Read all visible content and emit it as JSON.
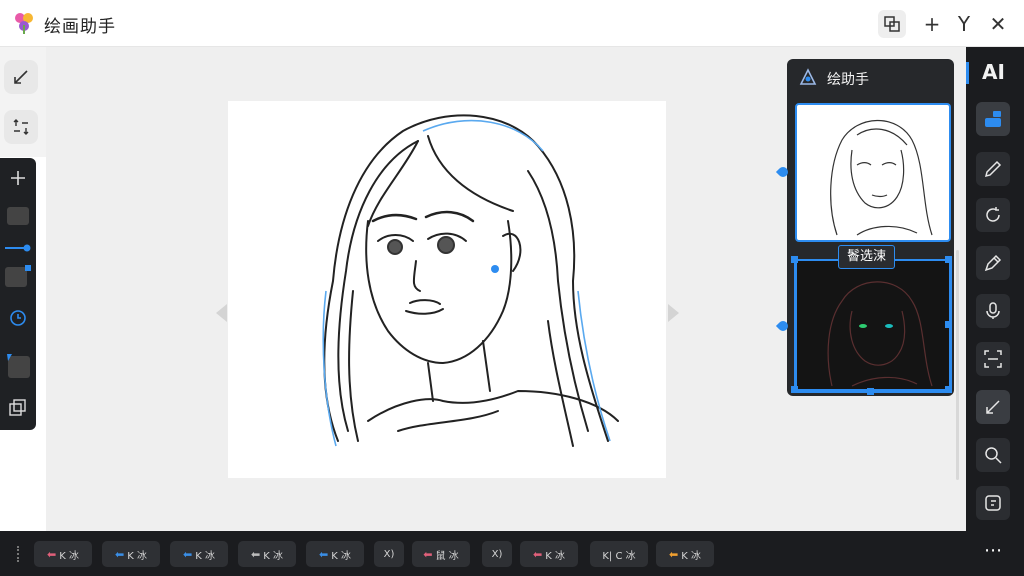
{
  "window": {
    "title": "绘画助手",
    "buttons": {
      "swap": "swap-icon",
      "add": "+",
      "pin": "Y",
      "close": "✕"
    }
  },
  "left_toolbar": {
    "top_tools": [
      "resize-diagonal-icon",
      "transform-arrows-icon"
    ],
    "dark_tools": [
      "plus-icon",
      "layer-block-icon",
      "slider-icon",
      "layer-block-icon",
      "rotate-icon",
      "layer-block-icon",
      "duplicate-icon"
    ]
  },
  "ai_panel": {
    "title": "绘助手",
    "selection_label": "鬠选涑"
  },
  "right_toolbar": {
    "label": "AI",
    "tools": [
      "layers-icon",
      "pencil-icon",
      "refresh-icon",
      "pen-icon",
      "microphone-icon",
      "scan-frame-icon",
      "resize-diagonal-icon",
      "search-icon",
      "export-icon"
    ],
    "more": "⋯"
  },
  "bottom_chips": [
    {
      "arrow": "⬅",
      "text": "K 冰",
      "color": "#e0607a"
    },
    {
      "arrow": "⬅",
      "text": "K 冰",
      "color": "#3a8ee6"
    },
    {
      "arrow": "⬅",
      "text": "K 冰",
      "color": "#3a8ee6"
    },
    {
      "arrow": "⬅",
      "text": "K 冰",
      "color": "#bbbbbb"
    },
    {
      "arrow": "⬅",
      "text": "K 冰",
      "color": "#3a8ee6"
    },
    {
      "arrow": "",
      "text": "X)",
      "color": "#bbbbbb"
    },
    {
      "arrow": "⬅",
      "text": "鼠 冰",
      "color": "#e0607a"
    },
    {
      "arrow": "",
      "text": "X)",
      "color": "#bbbbbb"
    },
    {
      "arrow": "⬅",
      "text": "K 冰",
      "color": "#e0607a"
    },
    {
      "arrow": "",
      "text": "K|  C 冰",
      "color": "#bbbbbb"
    },
    {
      "arrow": "⬅",
      "text": "K 冰",
      "color": "#f0a030"
    }
  ],
  "colors": {
    "accent": "#2d8cf0",
    "dark_panel": "#1b1c1f"
  }
}
